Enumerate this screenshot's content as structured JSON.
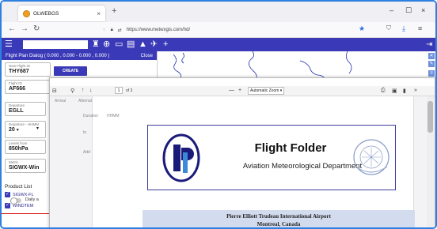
{
  "browser": {
    "tab_title": "OLWEBGS",
    "tab_close": "×",
    "new_tab": "+",
    "url": "https://www.metwxgis.com/hd/",
    "minimize": "–",
    "maximize": "☐",
    "close": "×"
  },
  "app": {
    "panel_title": "Flight Plan Dialog ( 0.000 , 0.000 - 0.000 , 0.000 )",
    "panel_close": "Close",
    "new_flight_id_label": "New Flight ID",
    "new_flight_id_value": "THY687",
    "create_label": "CREATE",
    "flight_id_label": "Flight ID",
    "flight_id_value": "AF666",
    "departure_label": "Departure",
    "departure_value": "EGLL",
    "departure_time_label": "Departure",
    "departure_time_unit": "HHMM",
    "departure_time_value": "20",
    "levels_label": "Levels from",
    "levels_value": "850hPa",
    "metric_label": "Metric",
    "metric_value": "SIGWX-Win",
    "product_list_label": "Product List",
    "products": [
      {
        "label": "SIGWX-FL",
        "checked": true
      },
      {
        "label": "WINDTEM",
        "checked": true
      }
    ],
    "daily_label": "Daily a"
  },
  "pdf": {
    "page_number": "1",
    "page_of": "of 3",
    "zoom": "Automatic Zoom",
    "close": "×",
    "ghost_arrival": "Arrival",
    "ghost_alternate": "Alternate Airports",
    "ghost_duration": "Duration",
    "ghost_hhmm": "HHMM",
    "ghost_to": "to",
    "ghost_add": "Add",
    "doc_title": "Flight Folder",
    "doc_subtitle": "Aviation Meteorological Department",
    "airport_name": "Pierre Elliott Trudeau International Airport",
    "airport_city": "Montreal, Canada"
  }
}
